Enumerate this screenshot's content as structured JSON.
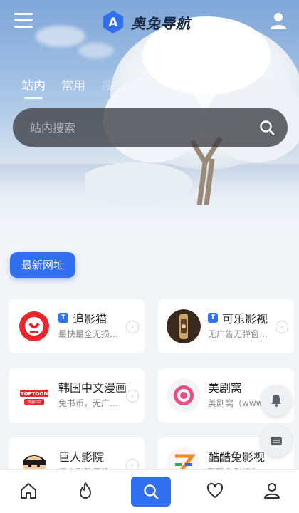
{
  "header": {
    "brand_name": "奥兔导航",
    "brand_letter": "A"
  },
  "tabs": [
    {
      "label": "站内"
    },
    {
      "label": "常用"
    },
    {
      "label": "搜"
    }
  ],
  "search": {
    "placeholder": "站内搜索"
  },
  "section": {
    "title": "最新网址"
  },
  "cards": [
    {
      "name": "追影猫",
      "badge": "T",
      "desc": "最快最全无损…"
    },
    {
      "name": "可乐影视",
      "badge": "T",
      "desc": "无广告无弹窗…"
    },
    {
      "name": "韩国中文漫画",
      "desc": "免书币，无广…",
      "logo_text": "TOPTOON",
      "logo_sub": "顶通中文"
    },
    {
      "name": "美剧窝",
      "desc": "美剧窝（www…"
    },
    {
      "name": "巨人影院",
      "desc": "巨人影院是清…"
    },
    {
      "name": "酷酷兔影视",
      "desc": "酷酷兔影视免…"
    }
  ],
  "colors": {
    "accent": "#2f6ff0",
    "brand_text": "#1b2a44"
  },
  "icons": {
    "menu": "menu-icon",
    "user": "user-icon",
    "search": "search-icon",
    "nav": [
      "home-icon",
      "fire-icon",
      "search-icon",
      "heart-icon",
      "user-icon"
    ],
    "float": [
      "bell-icon",
      "message-icon"
    ]
  }
}
